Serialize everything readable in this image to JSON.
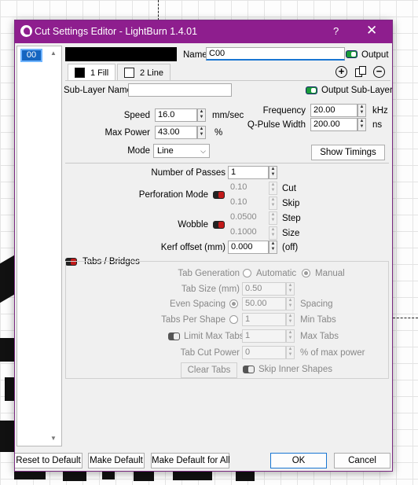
{
  "window": {
    "title": "Cut Settings Editor - LightBurn 1.4.01",
    "help": "?",
    "close": "✕"
  },
  "layers": {
    "items": [
      "00"
    ]
  },
  "name": {
    "label": "Name",
    "value": "C00"
  },
  "output": {
    "label": "Output",
    "enabled": true
  },
  "tabs": [
    {
      "label": "1 Fill",
      "swatch": "#000000"
    },
    {
      "label": "2 Line",
      "swatch": "#ffffff"
    }
  ],
  "sublayer": {
    "name_label": "Sub-Layer Name",
    "name_value": "",
    "output_label": "Output Sub-Layer",
    "output_enabled": true
  },
  "speed": {
    "label": "Speed",
    "value": "16.0",
    "unit": "mm/sec"
  },
  "max_power": {
    "label": "Max Power",
    "value": "43.00",
    "unit": "%"
  },
  "mode": {
    "label": "Mode",
    "value": "Line"
  },
  "frequency": {
    "label": "Frequency",
    "value": "20.00",
    "unit": "kHz"
  },
  "qpulse": {
    "label": "Q-Pulse Width",
    "value": "200.00",
    "unit": "ns"
  },
  "show_timings": "Show Timings",
  "passes": {
    "label": "Number of Passes",
    "value": "1"
  },
  "perforation": {
    "label": "Perforation Mode",
    "cut_value": "0.10",
    "cut_label": "Cut",
    "skip_value": "0.10",
    "skip_label": "Skip"
  },
  "wobble": {
    "label": "Wobble",
    "step_value": "0.0500",
    "step_label": "Step",
    "size_value": "0.1000",
    "size_label": "Size"
  },
  "kerf": {
    "label": "Kerf offset (mm)",
    "value": "0.000",
    "suffix": "(off)"
  },
  "tabs_bridges": {
    "label": "Tabs / Bridges",
    "generation_label": "Tab Generation",
    "automatic": "Automatic",
    "manual": "Manual",
    "tab_size_label": "Tab Size (mm)",
    "tab_size": "0.50",
    "even_spacing_label": "Even Spacing",
    "spacing_value": "50.00",
    "spacing_label": "Spacing",
    "per_shape_label": "Tabs Per Shape",
    "min_tabs_value": "1",
    "min_tabs_label": "Min Tabs",
    "limit_max_label": "Limit Max Tabs",
    "max_tabs_value": "1",
    "max_tabs_label": "Max Tabs",
    "cut_power_label": "Tab Cut Power",
    "cut_power_value": "0",
    "cut_power_unit": "% of max power",
    "clear_tabs": "Clear Tabs",
    "skip_inner": "Skip Inner Shapes"
  },
  "footer": {
    "reset": "Reset to Default",
    "make_default": "Make Default",
    "make_default_all": "Make Default for All",
    "ok": "OK",
    "cancel": "Cancel"
  },
  "colors": {
    "titlebar": "#8e1e8e",
    "selected": "#1565c0",
    "toggle_on": "#1a9c3a",
    "toggle_off": "#c21a1a"
  }
}
